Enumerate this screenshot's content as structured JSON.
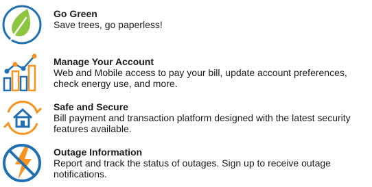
{
  "colors": {
    "accent_blue": "#1f6fb2",
    "leaf_green": "#8cc63f",
    "accent_orange": "#f7931e"
  },
  "features": [
    {
      "icon": "leaf-icon",
      "title": "Go Green",
      "description": "Save trees, go paperless!"
    },
    {
      "icon": "bar-chart-icon",
      "title": "Manage Your Account",
      "description": "Web and Mobile access to pay your bill, update account preferences, check energy use, and more."
    },
    {
      "icon": "secure-home-icon",
      "title": "Safe and Secure",
      "description": "Bill payment and transaction platform designed with the latest security features available."
    },
    {
      "icon": "outage-lightning-icon",
      "title": "Outage Information",
      "description": "Report and track the status of outages. Sign up to receive outage notifications."
    }
  ]
}
